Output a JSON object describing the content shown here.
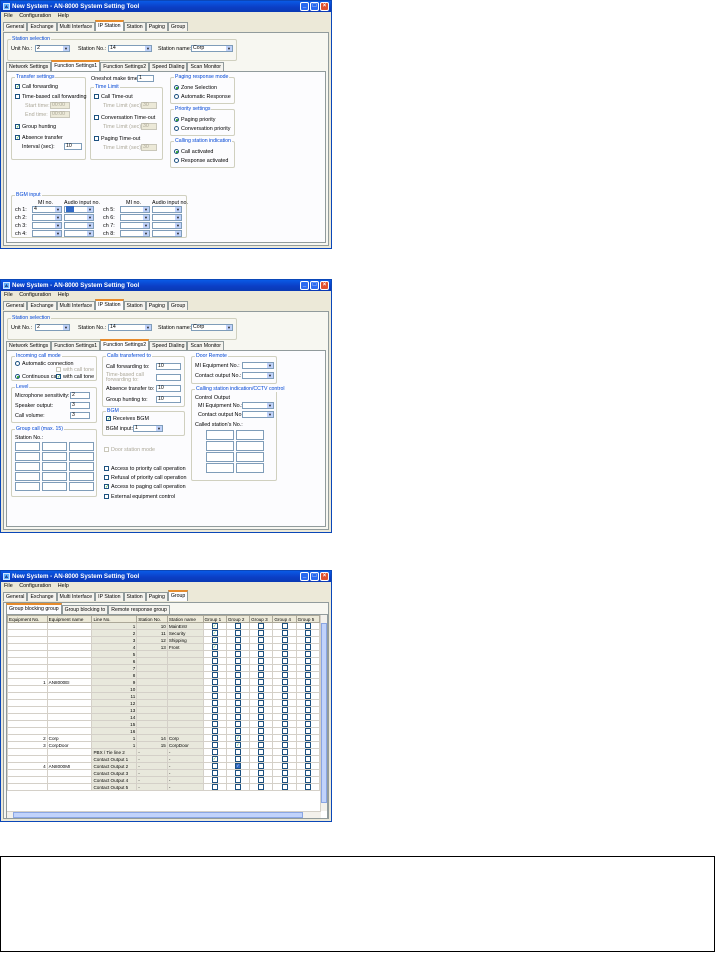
{
  "window": {
    "title": "New System - AN-8000 System Setting Tool",
    "menu": [
      "File",
      "Configuration",
      "Help"
    ],
    "main_tabs": [
      "General",
      "Exchange",
      "Multi Interface",
      "IP Station",
      "Station",
      "Paging",
      "Group"
    ]
  },
  "station_selection": {
    "label": "Station selection",
    "unit_label": "Unit No.:",
    "unit_value": "2",
    "station_no_label": "Station No.:",
    "station_no_value": "14",
    "station_name_label": "Station name:",
    "station_name_value": "Corp"
  },
  "sub_tabs": [
    "Network Settings",
    "Function Settings1",
    "Function Settings2",
    "Speed Dialing",
    "Scan Monitor"
  ],
  "fs1": {
    "transfer": {
      "label": "Transfer settings",
      "call_forwarding": "Call forwarding",
      "time_based": "Time-based call forwarding",
      "start_time_label": "Start time:",
      "start_time_value": "00:00",
      "end_time_label": "End time:",
      "end_time_value": "00:00",
      "group_hunting": "Group hunting",
      "absence_transfer": "Absence transfer",
      "interval_label": "Interval (sec):",
      "interval_value": "10"
    },
    "oneshot_label": "Oneshot make time:",
    "oneshot_value": "1",
    "time_limit": {
      "label": "Time Limit",
      "call_timeout": "Call Time-out",
      "conv_timeout": "Conversation Time-out",
      "paging_timeout": "Paging Time-out",
      "limit_label": "Time Limit (sec):",
      "call_value": "30",
      "conv_value": "30",
      "paging_value": "30"
    },
    "paging_response": {
      "label": "Paging response mode",
      "zone": "Zone Selection",
      "auto": "Automatic Response"
    },
    "priority": {
      "label": "Priority settings",
      "paging": "Paging priority",
      "conversation": "Conversation priority"
    },
    "calling_indication": {
      "label": "Calling station indication",
      "call_activated": "Call activated",
      "response_activated": "Response activated"
    },
    "bgm": {
      "label": "BGM input",
      "mi_no": "MI no.",
      "audio_input": "Audio input no.",
      "channels_left": [
        "ch 1:",
        "ch 2:",
        "ch 3:",
        "ch 4:"
      ],
      "channels_right": [
        "ch 5:",
        "ch 6:",
        "ch 7:",
        "ch 8:"
      ],
      "ch1_mi": "4"
    }
  },
  "fs2": {
    "incoming": {
      "label": "Incoming call mode",
      "auto_connection": "Automatic connection",
      "with_call_tone_disabled": "with call tone",
      "continuous_call": "Continuous call",
      "with_call_tone": "with call tone"
    },
    "level": {
      "label": "Level",
      "mic_label": "Microphone sensitivity:",
      "mic_value": "2",
      "speaker_label": "Speaker output:",
      "speaker_value": "3",
      "call_volume_label": "Call volume:",
      "call_volume_value": "3"
    },
    "group_call": {
      "label": "Group call (max. 15)",
      "station_no": "Station No.:"
    },
    "calls_transferred": {
      "label": "Calls transferred to",
      "forwarding_label": "Call forwarding to:",
      "forwarding_value": "10",
      "time_based_label": "Time-based call forwarding to:",
      "absence_label": "Absence transfer to:",
      "absence_value": "10",
      "hunting_label": "Group hunting to:",
      "hunting_value": "10"
    },
    "bgm": {
      "label": "BGM",
      "receives": "Receives BGM",
      "input_label": "BGM input:",
      "input_value": "1"
    },
    "door_station_mode": "Door station mode",
    "options": {
      "priority_access": "Access to priority call operation",
      "refusal_priority": "Refusal of priority call operation",
      "paging_access": "Access to paging call operation",
      "external_control": "External equipment control"
    },
    "door_remote": {
      "label": "Door Remote",
      "mi_equipment": "MI Equipment No.:",
      "contact_output": "Contact output No.:"
    },
    "cctv": {
      "label": "Calling station indication/CCTV control",
      "control_output": "Control Output",
      "mi_equipment": "MI Equipment No.:",
      "contact_output": "Contact output No.:",
      "called_station": "Called station's No.:"
    }
  },
  "group": {
    "sub_tabs": [
      "Group blocking group",
      "Group blocking to",
      "Remote response group"
    ],
    "headers": [
      "Equipment No.",
      "Equipment name",
      "Line No.",
      "Station No.",
      "Station name",
      "Group 1",
      "Group 2",
      "Group 3",
      "Group 4",
      "Group 5"
    ],
    "rows": [
      {
        "line": "1",
        "sno": "10",
        "sname": "MainEntr",
        "checks": [
          1,
          0,
          0,
          0,
          0
        ]
      },
      {
        "line": "2",
        "sno": "11",
        "sname": "Security",
        "checks": [
          1,
          0,
          0,
          0,
          0
        ]
      },
      {
        "line": "3",
        "sno": "12",
        "sname": "Shipping",
        "checks": [
          1,
          0,
          0,
          0,
          0
        ]
      },
      {
        "line": "4",
        "sno": "13",
        "sname": "Front",
        "checks": [
          1,
          0,
          0,
          0,
          0
        ]
      },
      {
        "line": "5",
        "sno": "",
        "sname": "",
        "checks": [
          0,
          0,
          0,
          0,
          0
        ]
      },
      {
        "line": "6",
        "sno": "",
        "sname": "",
        "checks": [
          0,
          0,
          0,
          0,
          0
        ]
      },
      {
        "line": "7",
        "sno": "",
        "sname": "",
        "checks": [
          0,
          0,
          0,
          0,
          0
        ]
      },
      {
        "line": "8",
        "sno": "",
        "sname": "",
        "checks": [
          0,
          0,
          0,
          0,
          0
        ]
      },
      {
        "eq_no": "1",
        "eq_name": "AN8000EI",
        "line": "9",
        "sno": "",
        "sname": "",
        "checks": [
          0,
          0,
          0,
          0,
          0
        ]
      },
      {
        "line": "10",
        "sno": "",
        "sname": "",
        "checks": [
          0,
          0,
          0,
          0,
          0
        ]
      },
      {
        "line": "11",
        "sno": "",
        "sname": "",
        "checks": [
          0,
          0,
          0,
          0,
          0
        ]
      },
      {
        "line": "12",
        "sno": "",
        "sname": "",
        "checks": [
          0,
          0,
          0,
          0,
          0
        ]
      },
      {
        "line": "13",
        "sno": "",
        "sname": "",
        "checks": [
          0,
          0,
          0,
          0,
          0
        ]
      },
      {
        "line": "14",
        "sno": "",
        "sname": "",
        "checks": [
          0,
          0,
          0,
          0,
          0
        ]
      },
      {
        "line": "15",
        "sno": "",
        "sname": "",
        "checks": [
          0,
          0,
          0,
          0,
          0
        ]
      },
      {
        "line": "16",
        "sno": "",
        "sname": "",
        "checks": [
          0,
          0,
          0,
          0,
          0
        ]
      },
      {
        "eq_no": "2",
        "eq_name": "Corp",
        "line": "1",
        "sno": "14",
        "sname": "Corp",
        "checks": [
          0,
          1,
          0,
          0,
          0
        ]
      },
      {
        "eq_no": "3",
        "eq_name": "CorpDoor",
        "line": "1",
        "sno": "15",
        "sname": "CorpDoor",
        "checks": [
          0,
          1,
          0,
          0,
          0
        ]
      },
      {
        "line_text": "PBX / Tie line 2",
        "sno": "-",
        "sname": "-",
        "checks": [
          0,
          0,
          0,
          0,
          0
        ]
      },
      {
        "line_text": "Contact Output 1",
        "sno": "-",
        "sname": "-",
        "checks": [
          1,
          0,
          0,
          0,
          0
        ]
      },
      {
        "eq_no": "4",
        "eq_name": "AN8000MI",
        "line_text": "Contact Output 2",
        "sno": "-",
        "sname": "-",
        "checks": [
          0,
          2,
          0,
          0,
          0
        ]
      },
      {
        "line_text": "Contact Output 3",
        "sno": "-",
        "sname": "-",
        "checks": [
          0,
          0,
          0,
          0,
          0
        ]
      },
      {
        "line_text": "Contact Output 4",
        "sno": "-",
        "sname": "-",
        "checks": [
          0,
          0,
          0,
          0,
          0
        ]
      },
      {
        "line_text": "Contact Output 5",
        "sno": "-",
        "sname": "-",
        "checks": [
          0,
          0,
          0,
          0,
          0
        ]
      }
    ]
  },
  "colors": {
    "title_bar": "#0b3fc6",
    "window_bg": "#ece9d8",
    "group_label": "#0046d5",
    "active_tab_accent": "#e68b2c",
    "selection": "#316ac5",
    "check": "#21a121"
  }
}
